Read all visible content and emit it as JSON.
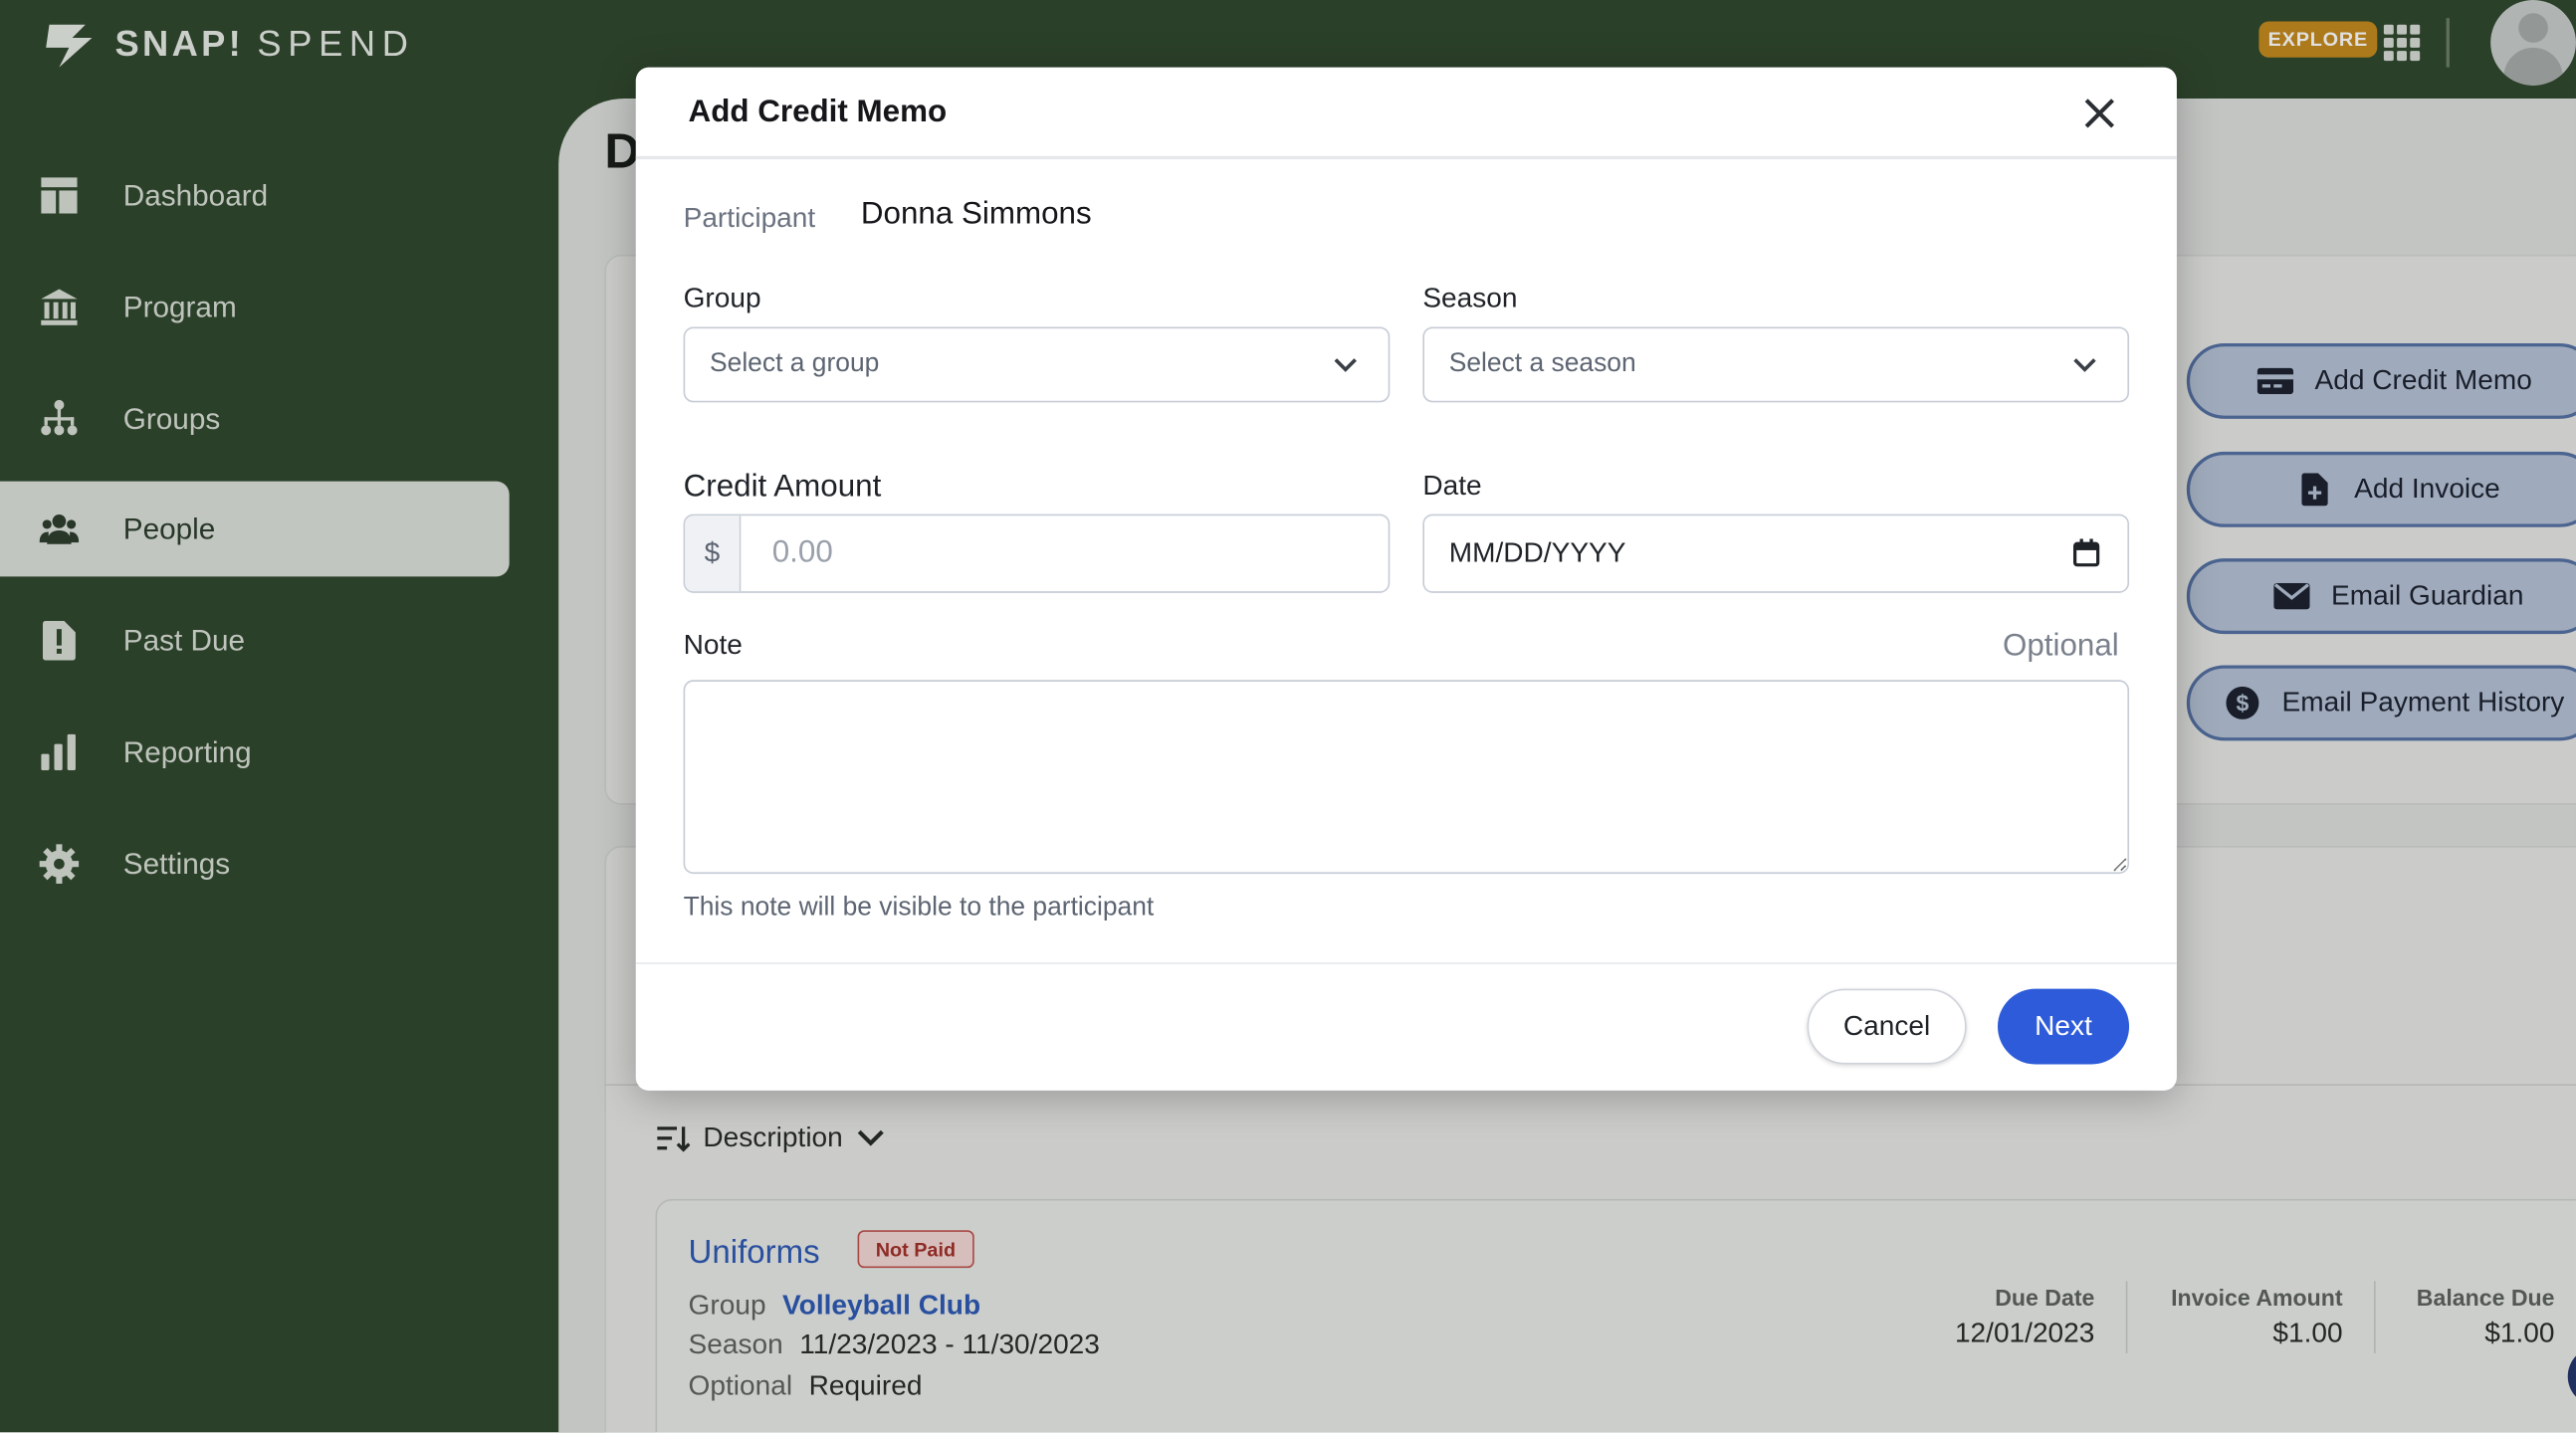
{
  "app": {
    "logo_primary": "SNAP!",
    "logo_secondary": "SPEND",
    "explore_label": "EXPLORE"
  },
  "sidebar": {
    "items": [
      {
        "label": "Dashboard",
        "icon": "dashboard-icon"
      },
      {
        "label": "Program",
        "icon": "bank-icon"
      },
      {
        "label": "Groups",
        "icon": "hierarchy-icon"
      },
      {
        "label": "People",
        "icon": "people-icon",
        "active": true
      },
      {
        "label": "Past Due",
        "icon": "alert-file-icon"
      },
      {
        "label": "Reporting",
        "icon": "bar-chart-icon"
      },
      {
        "label": "Settings",
        "icon": "gear-icon"
      }
    ]
  },
  "main": {
    "title_visible": "D",
    "actions": [
      {
        "label": "Add Credit Memo",
        "icon": "credit-card-icon"
      },
      {
        "label": "Add Invoice",
        "icon": "file-plus-icon"
      },
      {
        "label": "Email Guardian",
        "icon": "envelope-icon"
      },
      {
        "label": "Email Payment History",
        "icon": "dollar-circle-icon"
      }
    ],
    "sort_label": "Description",
    "invoice": {
      "title": "Uniforms",
      "status": "Not Paid",
      "group_key": "Group",
      "group_value": "Volleyball Club",
      "season_key": "Season",
      "season_value": "11/23/2023 - 11/30/2023",
      "optional_key": "Optional",
      "optional_value": "Required",
      "due_date_label": "Due Date",
      "due_date": "12/01/2023",
      "invoice_amount_label": "Invoice Amount",
      "invoice_amount": "$1.00",
      "balance_due_label": "Balance Due",
      "balance_due": "$1.00"
    }
  },
  "modal": {
    "title": "Add Credit Memo",
    "participant_label": "Participant",
    "participant_name": "Donna Simmons",
    "group_label": "Group",
    "group_placeholder": "Select a group",
    "season_label": "Season",
    "season_placeholder": "Select a season",
    "credit_amount_label": "Credit Amount",
    "currency_symbol": "$",
    "amount_placeholder": "0.00",
    "date_label": "Date",
    "date_placeholder": "MM/DD/YYYY",
    "note_label": "Note",
    "note_optional": "Optional",
    "note_helper": "This note will be visible to the participant",
    "cancel_label": "Cancel",
    "next_label": "Next"
  },
  "colors": {
    "sidebar_bg": "#31492f",
    "primary_button": "#2e5bd9",
    "explore_badge": "#c58b1f",
    "link": "#2f5bb5"
  }
}
